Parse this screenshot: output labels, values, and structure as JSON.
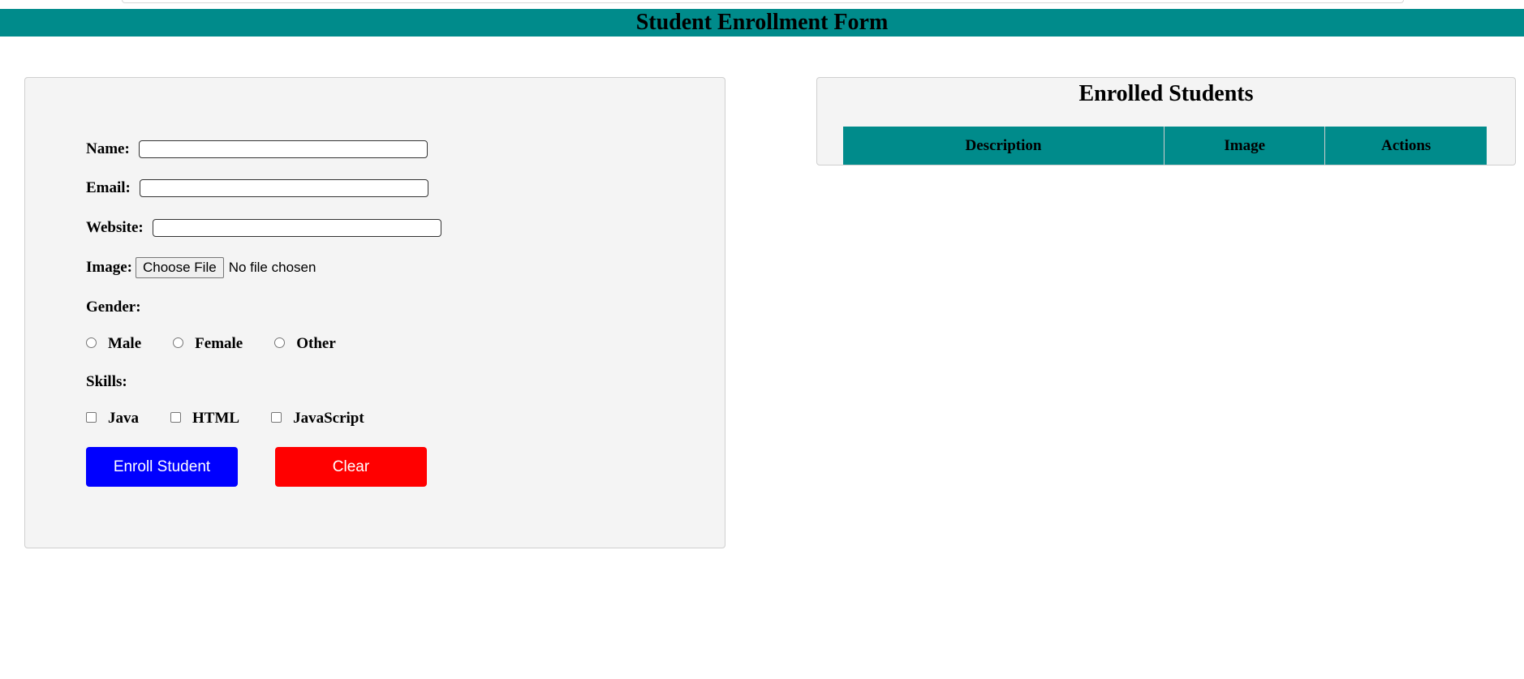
{
  "header": {
    "title": "Student Enrollment Form",
    "bg_color": "#008b8b"
  },
  "form": {
    "name_label": "Name:",
    "email_label": "Email:",
    "website_label": "Website:",
    "image_label": "Image:",
    "file_button_label": "Choose File",
    "file_status": "No file chosen",
    "gender_label": "Gender:",
    "gender_options": [
      "Male",
      "Female",
      "Other"
    ],
    "skills_label": "Skills:",
    "skill_options": [
      "Java",
      "HTML",
      "JavaScript"
    ],
    "enroll_button": "Enroll Student",
    "clear_button": "Clear",
    "enroll_color": "#0000ff",
    "clear_color": "#ff0000"
  },
  "list": {
    "title": "Enrolled Students",
    "columns": [
      "Description",
      "Image",
      "Actions"
    ]
  }
}
